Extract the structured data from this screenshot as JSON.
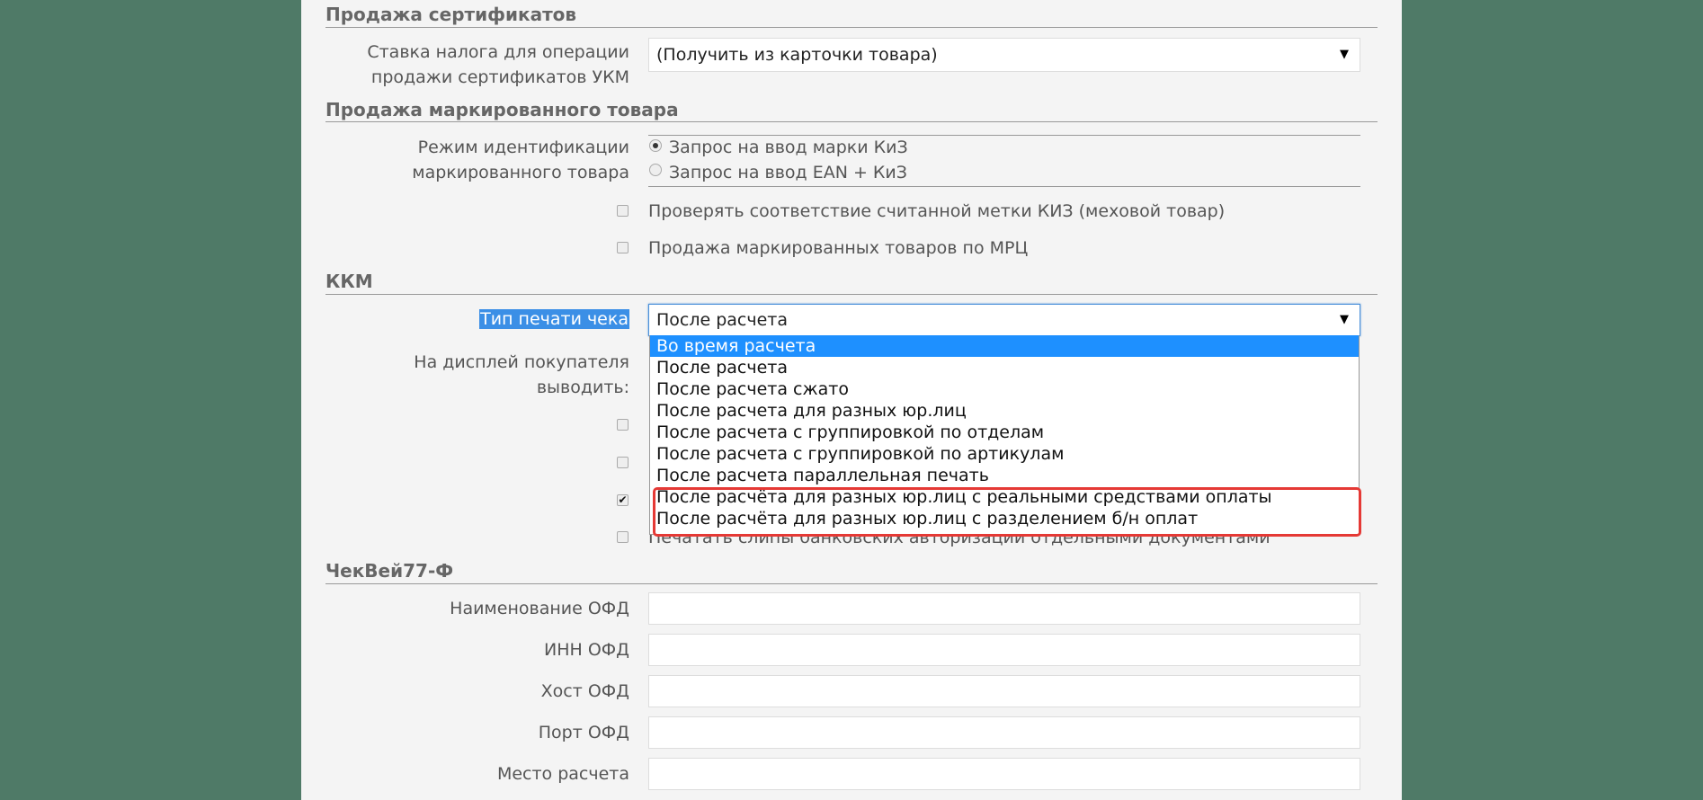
{
  "sections": {
    "certificates": "Продажа сертификатов",
    "marked": "Продажа маркированного товара",
    "kkm": "ККМ",
    "chekvey": "ЧекВей77-Ф"
  },
  "certificates": {
    "tax_label_line1": "Ставка налога для операции",
    "tax_label_line2": "продажи сертификатов УКМ",
    "tax_value": "(Получить из карточки товара)"
  },
  "marked": {
    "mode_label_line1": "Режим идентификации",
    "mode_label_line2": "маркированного товара",
    "radio_options": [
      "Запрос на ввод марки КиЗ",
      "Запрос на ввод EAN + КиЗ"
    ],
    "check_kiz": "Проверять соответствие считанной метки КИЗ (меховой товар)",
    "sell_mrp": "Продажа маркированных товаров по МРЦ"
  },
  "kkm": {
    "receipt_type_label": "Тип печати чека",
    "receipt_type_value": "После расчета",
    "display_label_line1": "На дисплей покупателя",
    "display_label_line2": "выводить:",
    "print_slips": "Печатать слипы банковских авторизаций отдельными документами",
    "options": [
      "Во время расчета",
      "После расчета",
      "После расчета сжато",
      "После расчета для разных юр.лиц",
      "После расчета с группировкой по отделам",
      "После расчета с группировкой по артикулам",
      "После расчета параллельная печать",
      "После расчёта для разных юр.лиц с реальными средствами оплаты",
      "После расчёта для разных юр.лиц с разделением б/н оплат"
    ]
  },
  "ofd": {
    "name_label": "Наименование ОФД",
    "inn_label": "ИНН ОФД",
    "host_label": "Хост ОФД",
    "port_label": "Порт ОФД",
    "place_label": "Место расчета"
  },
  "icons": {
    "dropdown_arrow": "▼",
    "checkmark": "✔"
  },
  "colors": {
    "background": "#4f7a67",
    "selection": "#1e90ff",
    "annotation": "#e53935"
  }
}
